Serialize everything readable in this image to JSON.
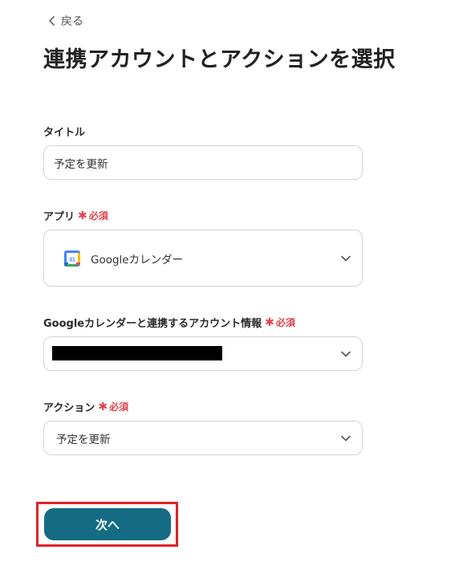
{
  "header": {
    "back_label": "戻る",
    "title": "連携アカウントとアクションを選択"
  },
  "form": {
    "required_label": "必須",
    "title_field": {
      "label": "タイトル",
      "value": "予定を更新"
    },
    "app_field": {
      "label": "アプリ",
      "value": "Googleカレンダー",
      "icon": "google-calendar-icon"
    },
    "account_field": {
      "label": "Googleカレンダーと連携するアカウント情報",
      "value_redacted": true
    },
    "action_field": {
      "label": "アクション",
      "value": "予定を更新"
    }
  },
  "footer": {
    "next_label": "次へ"
  },
  "colors": {
    "primary_button": "#146b83",
    "required": "#e0454f",
    "highlight_border": "#e0232a"
  }
}
